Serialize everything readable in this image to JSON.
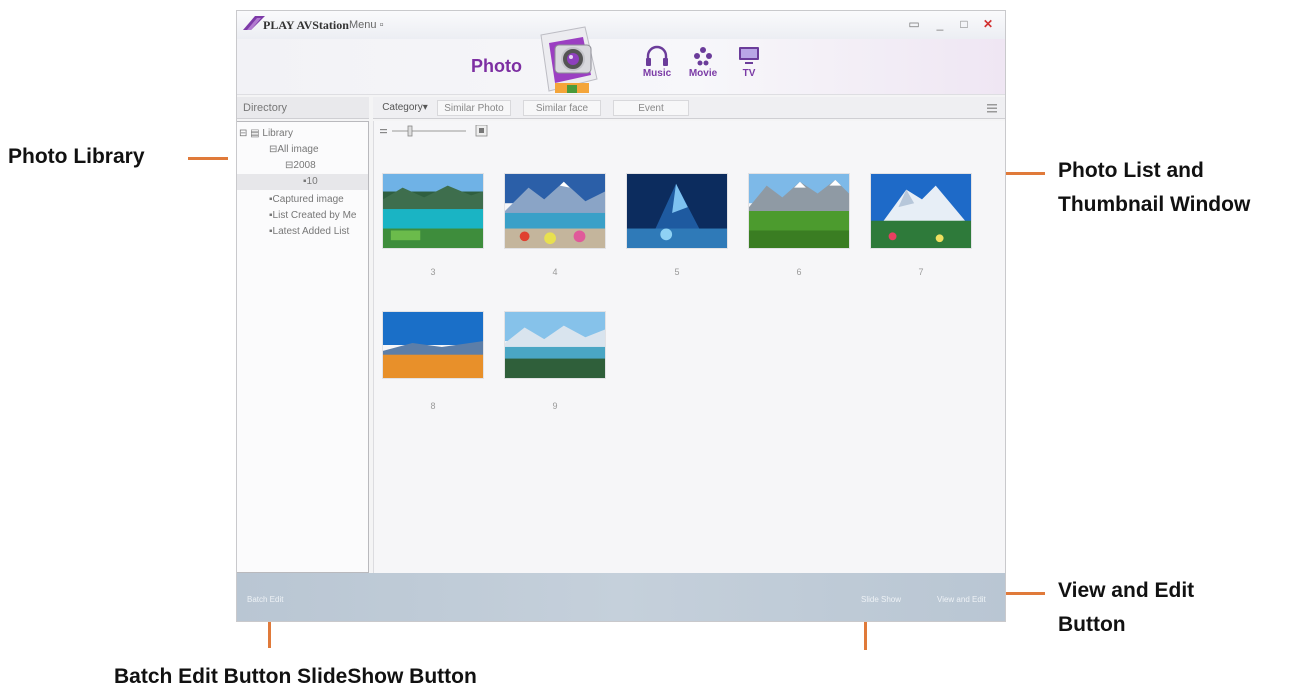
{
  "callouts": {
    "photo_library": "Photo Library",
    "photo_list_line1": "Photo List and",
    "photo_list_line2": "Thumbnail Window",
    "view_edit_line1": "View and Edit",
    "view_edit_line2": "Button",
    "batch_slideshow": "Batch Edit Button SlideShow Button"
  },
  "colors": {
    "callout_line": "#e07a3a",
    "accent": "#7d2fa2",
    "close": "#d23030"
  },
  "app": {
    "title": "PLAY AVStation",
    "menu_label": "Menu ▫",
    "window_controls": [
      "▭",
      "_",
      "□",
      "✕"
    ]
  },
  "header": {
    "photo_label": "Photo",
    "media_buttons": [
      {
        "label": "Music",
        "icon": "headphones-icon"
      },
      {
        "label": "Movie",
        "icon": "film-reel-icon"
      },
      {
        "label": "TV",
        "icon": "tv-icon"
      }
    ]
  },
  "directory": {
    "header": "Directory",
    "tree": [
      {
        "label": "⊟ ▤ Library"
      },
      {
        "label": "⊟All image"
      },
      {
        "label": "⊟2008"
      },
      {
        "label": "▪10"
      },
      {
        "label": "▪Captured image"
      },
      {
        "label": "▪List Created by Me"
      },
      {
        "label": "▪Latest Added List"
      }
    ]
  },
  "tabs": [
    "Category▾",
    "Similar Photo",
    "Similar face",
    "Event"
  ],
  "thumbnails": [
    {
      "number": "3",
      "scene": "alpine lake"
    },
    {
      "number": "4",
      "scene": "mountain lake flowers"
    },
    {
      "number": "5",
      "scene": "blue glacier"
    },
    {
      "number": "6",
      "scene": "green valley"
    },
    {
      "number": "7",
      "scene": "snowy peak"
    },
    {
      "number": "8",
      "scene": "orange field"
    },
    {
      "number": "9",
      "scene": "lake panorama"
    }
  ],
  "bottom_bar": {
    "batch_edit": "Batch Edit",
    "slide_show": "Slide Show",
    "view_and_edit": "View and Edit"
  }
}
